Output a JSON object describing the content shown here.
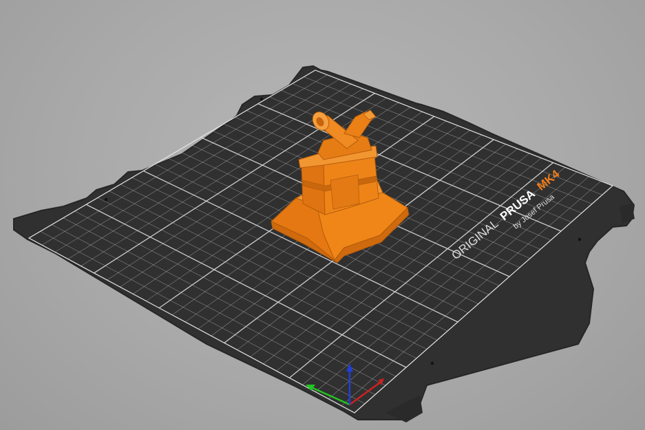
{
  "viewport": {
    "background": "#acacac",
    "bed": {
      "color": "#2e2e2e",
      "grid_color": "#d6d6d6",
      "logo": {
        "line1_prefix": "ORIGINAL",
        "line1_brand": "PRUSA",
        "line1_model": "MK4",
        "line2": "by Josef Prusa",
        "accent_color": "#f07d18"
      }
    },
    "model": {
      "color": "#e8780f",
      "shade_color": "#b55c0a",
      "highlight_color": "#f59a3a"
    },
    "axes": {
      "x_color": "#d12020",
      "y_color": "#22c422",
      "z_color": "#1f3fd6",
      "x_icon": "x-axis-arrow-icon",
      "y_icon": "y-axis-arrow-icon",
      "z_icon": "z-axis-arrow-icon"
    }
  }
}
